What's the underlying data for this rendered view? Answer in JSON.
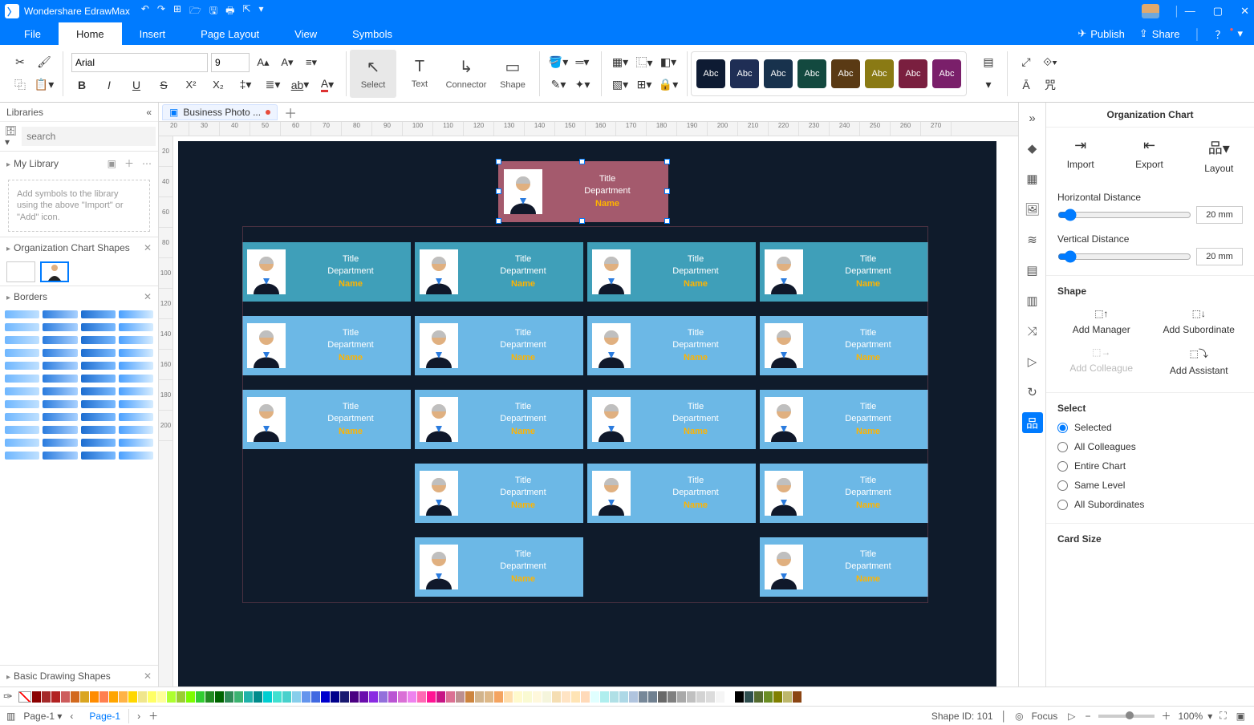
{
  "app": {
    "title": "Wondershare EdrawMax"
  },
  "menus": {
    "file": "File",
    "home": "Home",
    "insert": "Insert",
    "page_layout": "Page Layout",
    "view": "View",
    "symbols": "Symbols",
    "publish": "Publish",
    "share": "Share"
  },
  "ribbon": {
    "font_family": "Arial",
    "font_size": "9",
    "tool_select": "Select",
    "tool_text": "Text",
    "tool_connector": "Connector",
    "tool_shape": "Shape",
    "swatch_label": "Abc"
  },
  "left": {
    "libraries": "Libraries",
    "search_placeholder": "search",
    "my_library": "My Library",
    "hint": "Add symbols to the library using the above \"Import\" or \"Add\" icon.",
    "org_shapes": "Organization Chart Shapes",
    "borders": "Borders",
    "basic_shapes": "Basic Drawing Shapes"
  },
  "doc": {
    "tab": "Business Photo ...",
    "page_tab": "Page-1",
    "page_sel": "Page-1"
  },
  "ruler_h": [
    "20",
    "30",
    "40",
    "50",
    "60",
    "70",
    "80",
    "90",
    "100",
    "110",
    "120",
    "130",
    "140",
    "150",
    "160",
    "170",
    "180",
    "190",
    "200",
    "210",
    "220",
    "230",
    "240",
    "250",
    "260",
    "270"
  ],
  "ruler_v": [
    "20",
    "40",
    "60",
    "80",
    "100",
    "120",
    "140",
    "160",
    "180",
    "200"
  ],
  "card": {
    "title": "Title",
    "dept": "Department",
    "name": "Name"
  },
  "right": {
    "title": "Organization Chart",
    "import": "Import",
    "export": "Export",
    "layout": "Layout",
    "hdist": "Horizontal Distance",
    "vdist": "Vertical Distance",
    "hval": "20 mm",
    "vval": "20 mm",
    "shape": "Shape",
    "add_manager": "Add Manager",
    "add_subordinate": "Add Subordinate",
    "add_colleague": "Add Colleague",
    "add_assistant": "Add Assistant",
    "select": "Select",
    "r_selected": "Selected",
    "r_colleagues": "All Colleagues",
    "r_chart": "Entire Chart",
    "r_level": "Same Level",
    "r_subs": "All Subordinates",
    "card_size": "Card Size"
  },
  "status": {
    "shape_id": "Shape ID: 101",
    "focus": "Focus",
    "zoom": "100%"
  },
  "swatch_colors": [
    "#0e1b33",
    "#1f2e55",
    "#18324d",
    "#13493f",
    "#5a3a14",
    "#8a7a14",
    "#7a1f3f",
    "#7a1f6a"
  ],
  "palette": [
    "#8b0000",
    "#a52a2a",
    "#b22222",
    "#cd5c5c",
    "#d2691e",
    "#daa520",
    "#ff8c00",
    "#ff7f50",
    "#ffa500",
    "#ffb347",
    "#ffd700",
    "#f0e68c",
    "#ffff66",
    "#ffff99",
    "#adff2f",
    "#9acd32",
    "#7cfc00",
    "#32cd32",
    "#228b22",
    "#006400",
    "#2e8b57",
    "#3cb371",
    "#20b2aa",
    "#008b8b",
    "#00ced1",
    "#40e0d0",
    "#48d1cc",
    "#87ceeb",
    "#6495ed",
    "#4169e1",
    "#0000cd",
    "#00008b",
    "#191970",
    "#4b0082",
    "#6a0dad",
    "#8a2be2",
    "#9370db",
    "#ba55d3",
    "#da70d6",
    "#ee82ee",
    "#ff69b4",
    "#ff1493",
    "#c71585",
    "#db7093",
    "#bc8f8f",
    "#cd853f",
    "#d2b48c",
    "#deb887",
    "#f4a460",
    "#ffdead",
    "#fffacd",
    "#fafad2",
    "#fff8dc",
    "#f5f5dc",
    "#f5deb3",
    "#ffe4c4",
    "#ffe4b5",
    "#ffdab9",
    "#e0ffff",
    "#afeeee",
    "#b0e0e6",
    "#add8e6",
    "#b0c4de",
    "#778899",
    "#708090",
    "#696969",
    "#808080",
    "#a9a9a9",
    "#c0c0c0",
    "#d3d3d3",
    "#dcdcdc",
    "#f5f5f5",
    "#ffffff",
    "#000000",
    "#2f4f4f",
    "#556b2f",
    "#6b8e23",
    "#808000",
    "#bdb76b",
    "#8b4513"
  ]
}
